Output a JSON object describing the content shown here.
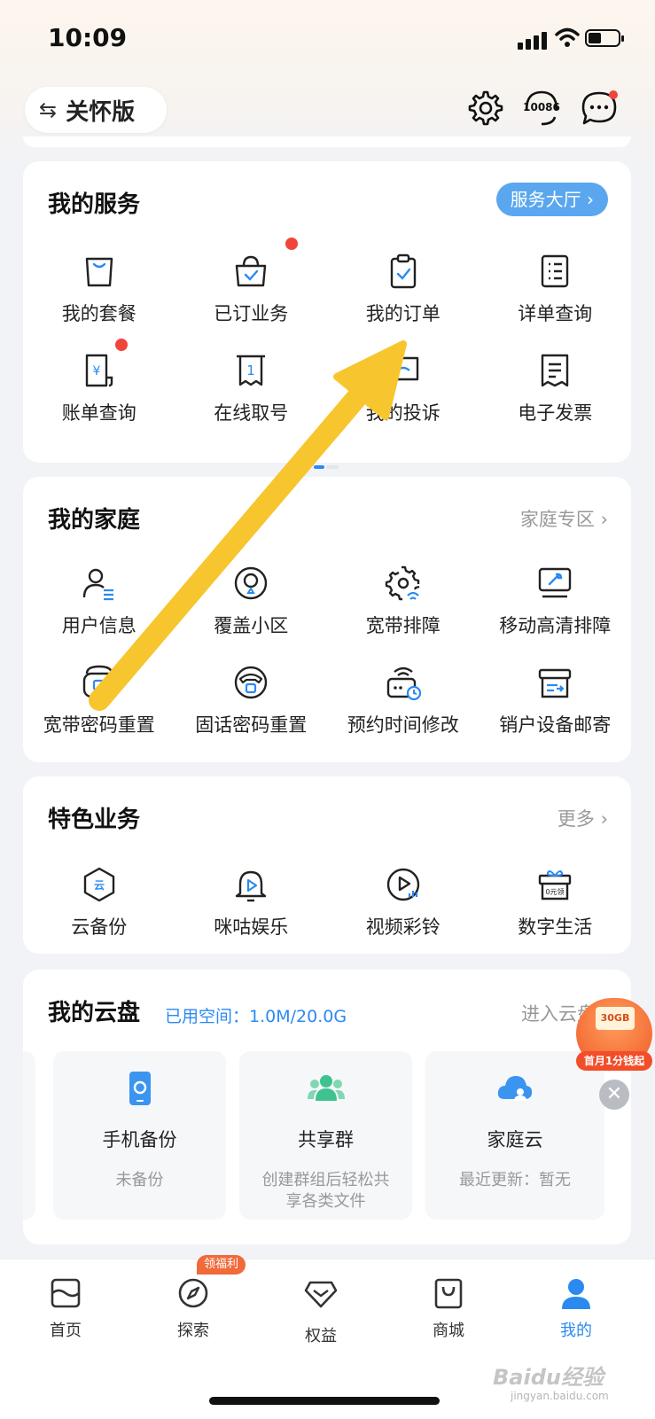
{
  "status": {
    "time": "10:09"
  },
  "header": {
    "care_mode": "关怀版",
    "service_number": "10086"
  },
  "services": {
    "title": "我的服务",
    "hall_button": "服务大厅 ›",
    "items": [
      {
        "label": "我的套餐",
        "icon": "package-bag-icon"
      },
      {
        "label": "已订业务",
        "icon": "subscribed-bag-icon"
      },
      {
        "label": "我的订单",
        "icon": "order-clipboard-icon"
      },
      {
        "label": "详单查询",
        "icon": "detail-list-icon"
      },
      {
        "label": "账单查询",
        "icon": "bill-icon"
      },
      {
        "label": "在线取号",
        "icon": "queue-ticket-icon"
      },
      {
        "label": "我的投诉",
        "icon": "complaint-chat-icon"
      },
      {
        "label": "电子发票",
        "icon": "invoice-icon"
      }
    ]
  },
  "family": {
    "title": "我的家庭",
    "link": "家庭专区 ›",
    "items": [
      {
        "label": "用户信息",
        "icon": "user-info-icon"
      },
      {
        "label": "覆盖小区",
        "icon": "coverage-icon"
      },
      {
        "label": "宽带排障",
        "icon": "broadband-gear-icon"
      },
      {
        "label": "移动高清排障",
        "icon": "tv-repair-icon"
      },
      {
        "label": "宽带密码重置",
        "icon": "router-lock-icon"
      },
      {
        "label": "固话密码重置",
        "icon": "phone-lock-icon"
      },
      {
        "label": "预约时间修改",
        "icon": "router-clock-icon"
      },
      {
        "label": "销户设备邮寄",
        "icon": "box-mail-icon"
      }
    ]
  },
  "featured": {
    "title": "特色业务",
    "link": "更多 ›",
    "items": [
      {
        "label": "云备份",
        "icon": "cloud-backup-icon"
      },
      {
        "label": "咪咕娱乐",
        "icon": "migu-bell-icon"
      },
      {
        "label": "视频彩铃",
        "icon": "video-ring-icon"
      },
      {
        "label": "数字生活",
        "icon": "gift-box-icon"
      }
    ],
    "gift_tag": "0元领"
  },
  "cloud_disk": {
    "title": "我的云盘",
    "used": "已用空间：1.0M/20.0G",
    "link": "进入云盘",
    "cards": [
      {
        "name": "手机备份",
        "sub": "未备份"
      },
      {
        "name": "共享群",
        "sub": "创建群组后轻松共享各类文件"
      },
      {
        "name": "家庭云",
        "sub": "最近更新：暂无"
      }
    ]
  },
  "promo": {
    "tag": "30GB",
    "label": "首月1分钱起"
  },
  "tabbar": {
    "badge": "领福利",
    "tabs": [
      {
        "label": "首页"
      },
      {
        "label": "探索"
      },
      {
        "label": "权益"
      },
      {
        "label": "商城"
      },
      {
        "label": "我的"
      }
    ]
  },
  "colors": {
    "accent": "#2a8af0",
    "annotation_arrow": "#f7c52e",
    "red_dot": "#f0453a"
  },
  "watermark": {
    "brand": "Baidu经验",
    "url": "jingyan.baidu.com"
  }
}
